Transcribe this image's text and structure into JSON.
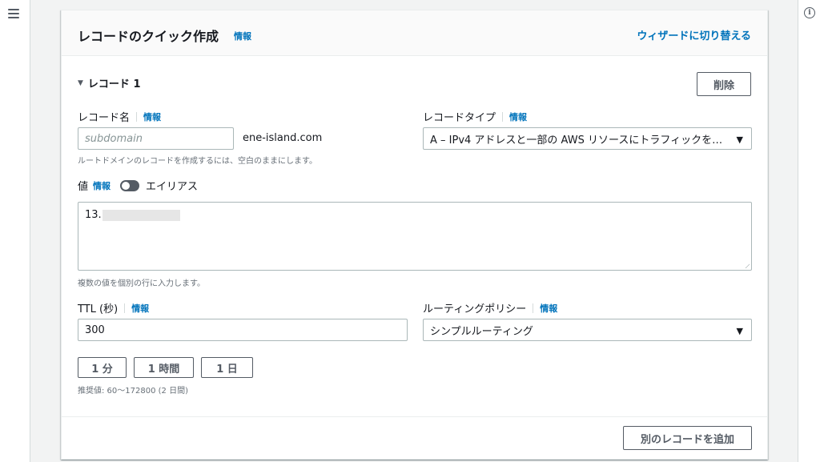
{
  "panel": {
    "title": "レコードのクイック作成",
    "title_info": "情報",
    "wizard_link": "ウィザードに切り替える"
  },
  "record": {
    "heading": "レコード 1",
    "delete_button": "削除",
    "name": {
      "label": "レコード名",
      "info": "情報",
      "placeholder": "subdomain",
      "domain_suffix": "ene-island.com",
      "helper": "ルートドメインのレコードを作成するには、空白のままにします。"
    },
    "type": {
      "label": "レコードタイプ",
      "info": "情報",
      "selected": "A – IPv4 アドレスと一部の AWS リソースにトラフィックを…"
    },
    "value": {
      "label": "値",
      "info": "情報",
      "alias_label": "エイリアス",
      "alias_enabled": false,
      "text": "13.",
      "helper": "複数の値を個別の行に入力します。"
    },
    "ttl": {
      "label": "TTL (秒)",
      "info": "情報",
      "value": "300",
      "presets": [
        "1 分",
        "1 時間",
        "1 日"
      ],
      "helper": "推奨値: 60〜172800 (2 日間)"
    },
    "routing": {
      "label": "ルーティングポリシー",
      "info": "情報",
      "selected": "シンプルルーティング"
    }
  },
  "add_record_button": "別のレコードを追加",
  "colors": {
    "link": "#0073bb",
    "border": "#aab7b8",
    "background": "#f2f3f3"
  }
}
